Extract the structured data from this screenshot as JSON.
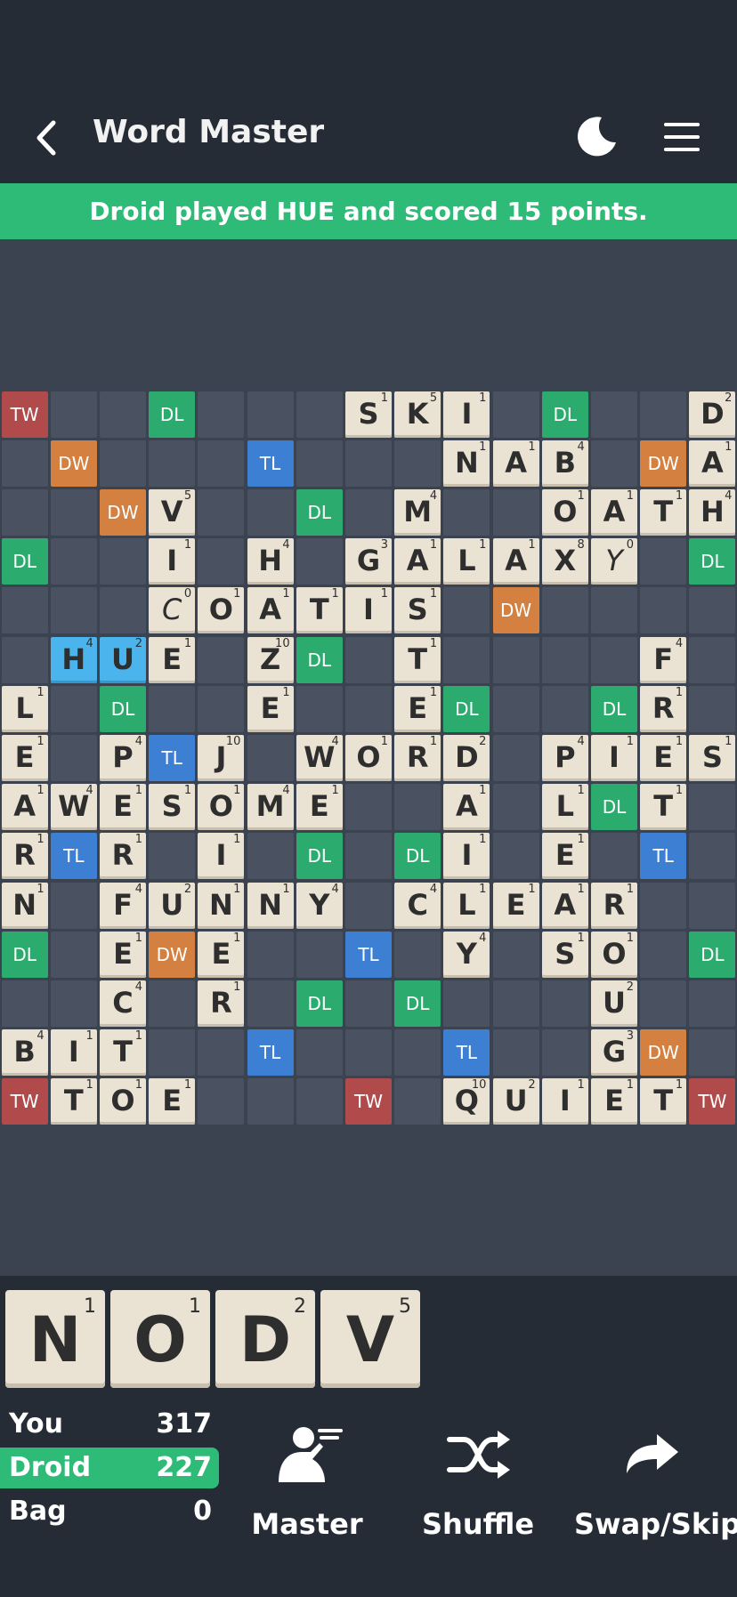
{
  "header": {
    "title": "Word Master",
    "back_icon": "chevron-left-icon",
    "theme_icon": "moon-icon",
    "menu_icon": "hamburger-menu-icon"
  },
  "banner": {
    "text": "Droid played HUE and scored 15 points."
  },
  "colors": {
    "header_bg": "#262c36",
    "board_bg": "#3b4351",
    "accent_green": "#2dbb77",
    "TW": "#b14b4b",
    "DW": "#d48040",
    "DL": "#2bab6e",
    "TL": "#3c7fd3",
    "tile": "#eae2d3",
    "last_played": "#4cb4ec"
  },
  "board": {
    "premiums": [
      [
        "TW",
        "",
        "",
        "DL",
        "",
        "",
        "",
        "",
        "",
        "",
        "",
        "DL",
        "",
        "",
        "TW"
      ],
      [
        "",
        "DW",
        "",
        "",
        "",
        "TL",
        "",
        "",
        "",
        "",
        "",
        "",
        "",
        "DW",
        ""
      ],
      [
        "",
        "",
        "DW",
        "",
        "",
        "",
        "DL",
        "",
        "",
        "",
        "",
        "",
        "",
        "",
        ""
      ],
      [
        "DL",
        "",
        "",
        "",
        "",
        "",
        "",
        "",
        "",
        "",
        "",
        "",
        "",
        "",
        "DL"
      ],
      [
        "",
        "",
        "",
        "",
        "",
        "",
        "",
        "",
        "",
        "",
        "DW",
        "",
        "",
        "",
        ""
      ],
      [
        "",
        "",
        "",
        "",
        "",
        "",
        "DL",
        "",
        "",
        "",
        "",
        "",
        "",
        "",
        ""
      ],
      [
        "",
        "",
        "DL",
        "",
        "",
        "",
        "",
        "",
        "",
        "DL",
        "",
        "",
        "DL",
        "",
        ""
      ],
      [
        "",
        "",
        "",
        "TL",
        "",
        "",
        "",
        "",
        "",
        "",
        "",
        "",
        "",
        "",
        ""
      ],
      [
        "",
        "",
        "",
        "",
        "",
        "",
        "",
        "",
        "",
        "",
        "",
        "",
        "DL",
        "",
        ""
      ],
      [
        "",
        "TL",
        "",
        "",
        "",
        "",
        "DL",
        "",
        "DL",
        "",
        "",
        "",
        "",
        "TL",
        ""
      ],
      [
        "",
        "",
        "",
        "",
        "",
        "",
        "",
        "",
        "",
        "",
        "",
        "",
        "",
        "",
        ""
      ],
      [
        "DL",
        "",
        "",
        "DW",
        "",
        "",
        "",
        "TL",
        "",
        "",
        "",
        "",
        "",
        "",
        "DL"
      ],
      [
        "",
        "",
        "",
        "",
        "",
        "",
        "DL",
        "",
        "DL",
        "",
        "",
        "",
        "",
        "",
        ""
      ],
      [
        "",
        "",
        "",
        "",
        "",
        "TL",
        "",
        "",
        "",
        "TL",
        "",
        "",
        "",
        "DW",
        ""
      ],
      [
        "TW",
        "",
        "",
        "",
        "",
        "",
        "",
        "TW",
        "",
        "",
        "",
        "",
        "",
        "",
        "TW"
      ]
    ],
    "tiles": [
      {
        "r": 0,
        "c": 7,
        "letter": "S",
        "points": 1
      },
      {
        "r": 0,
        "c": 8,
        "letter": "K",
        "points": 5
      },
      {
        "r": 0,
        "c": 9,
        "letter": "I",
        "points": 1
      },
      {
        "r": 0,
        "c": 14,
        "letter": "D",
        "points": 2
      },
      {
        "r": 1,
        "c": 9,
        "letter": "N",
        "points": 1
      },
      {
        "r": 1,
        "c": 10,
        "letter": "A",
        "points": 1
      },
      {
        "r": 1,
        "c": 11,
        "letter": "B",
        "points": 4
      },
      {
        "r": 1,
        "c": 14,
        "letter": "A",
        "points": 1
      },
      {
        "r": 2,
        "c": 3,
        "letter": "V",
        "points": 5
      },
      {
        "r": 2,
        "c": 8,
        "letter": "M",
        "points": 4
      },
      {
        "r": 2,
        "c": 11,
        "letter": "O",
        "points": 1
      },
      {
        "r": 2,
        "c": 12,
        "letter": "A",
        "points": 1
      },
      {
        "r": 2,
        "c": 13,
        "letter": "T",
        "points": 1
      },
      {
        "r": 2,
        "c": 14,
        "letter": "H",
        "points": 4
      },
      {
        "r": 3,
        "c": 3,
        "letter": "I",
        "points": 1
      },
      {
        "r": 3,
        "c": 5,
        "letter": "H",
        "points": 4
      },
      {
        "r": 3,
        "c": 7,
        "letter": "G",
        "points": 3
      },
      {
        "r": 3,
        "c": 8,
        "letter": "A",
        "points": 1
      },
      {
        "r": 3,
        "c": 9,
        "letter": "L",
        "points": 1
      },
      {
        "r": 3,
        "c": 10,
        "letter": "A",
        "points": 1
      },
      {
        "r": 3,
        "c": 11,
        "letter": "X",
        "points": 8
      },
      {
        "r": 3,
        "c": 12,
        "letter": "Y",
        "points": 0,
        "blank": true
      },
      {
        "r": 4,
        "c": 3,
        "letter": "C",
        "points": 0,
        "blank": true
      },
      {
        "r": 4,
        "c": 4,
        "letter": "O",
        "points": 1
      },
      {
        "r": 4,
        "c": 5,
        "letter": "A",
        "points": 1
      },
      {
        "r": 4,
        "c": 6,
        "letter": "T",
        "points": 1
      },
      {
        "r": 4,
        "c": 7,
        "letter": "I",
        "points": 1
      },
      {
        "r": 4,
        "c": 8,
        "letter": "S",
        "points": 1
      },
      {
        "r": 5,
        "c": 1,
        "letter": "H",
        "points": 4,
        "last": true
      },
      {
        "r": 5,
        "c": 2,
        "letter": "U",
        "points": 2,
        "last": true
      },
      {
        "r": 5,
        "c": 3,
        "letter": "E",
        "points": 1
      },
      {
        "r": 5,
        "c": 5,
        "letter": "Z",
        "points": 10
      },
      {
        "r": 5,
        "c": 8,
        "letter": "T",
        "points": 1
      },
      {
        "r": 5,
        "c": 13,
        "letter": "F",
        "points": 4
      },
      {
        "r": 6,
        "c": 0,
        "letter": "L",
        "points": 1
      },
      {
        "r": 6,
        "c": 5,
        "letter": "E",
        "points": 1
      },
      {
        "r": 6,
        "c": 8,
        "letter": "E",
        "points": 1
      },
      {
        "r": 6,
        "c": 13,
        "letter": "R",
        "points": 1
      },
      {
        "r": 7,
        "c": 0,
        "letter": "E",
        "points": 1
      },
      {
        "r": 7,
        "c": 2,
        "letter": "P",
        "points": 4
      },
      {
        "r": 7,
        "c": 4,
        "letter": "J",
        "points": 10
      },
      {
        "r": 7,
        "c": 6,
        "letter": "W",
        "points": 4
      },
      {
        "r": 7,
        "c": 7,
        "letter": "O",
        "points": 1
      },
      {
        "r": 7,
        "c": 8,
        "letter": "R",
        "points": 1
      },
      {
        "r": 7,
        "c": 9,
        "letter": "D",
        "points": 2
      },
      {
        "r": 7,
        "c": 11,
        "letter": "P",
        "points": 4
      },
      {
        "r": 7,
        "c": 12,
        "letter": "I",
        "points": 1
      },
      {
        "r": 7,
        "c": 13,
        "letter": "E",
        "points": 1
      },
      {
        "r": 7,
        "c": 14,
        "letter": "S",
        "points": 1
      },
      {
        "r": 8,
        "c": 0,
        "letter": "A",
        "points": 1
      },
      {
        "r": 8,
        "c": 1,
        "letter": "W",
        "points": 4
      },
      {
        "r": 8,
        "c": 2,
        "letter": "E",
        "points": 1
      },
      {
        "r": 8,
        "c": 3,
        "letter": "S",
        "points": 1
      },
      {
        "r": 8,
        "c": 4,
        "letter": "O",
        "points": 1
      },
      {
        "r": 8,
        "c": 5,
        "letter": "M",
        "points": 4
      },
      {
        "r": 8,
        "c": 6,
        "letter": "E",
        "points": 1
      },
      {
        "r": 8,
        "c": 9,
        "letter": "A",
        "points": 1
      },
      {
        "r": 8,
        "c": 11,
        "letter": "L",
        "points": 1
      },
      {
        "r": 8,
        "c": 13,
        "letter": "T",
        "points": 1
      },
      {
        "r": 9,
        "c": 0,
        "letter": "R",
        "points": 1
      },
      {
        "r": 9,
        "c": 2,
        "letter": "R",
        "points": 1
      },
      {
        "r": 9,
        "c": 4,
        "letter": "I",
        "points": 1
      },
      {
        "r": 9,
        "c": 9,
        "letter": "I",
        "points": 1
      },
      {
        "r": 9,
        "c": 11,
        "letter": "E",
        "points": 1
      },
      {
        "r": 10,
        "c": 0,
        "letter": "N",
        "points": 1
      },
      {
        "r": 10,
        "c": 2,
        "letter": "F",
        "points": 4
      },
      {
        "r": 10,
        "c": 3,
        "letter": "U",
        "points": 2
      },
      {
        "r": 10,
        "c": 4,
        "letter": "N",
        "points": 1
      },
      {
        "r": 10,
        "c": 5,
        "letter": "N",
        "points": 1
      },
      {
        "r": 10,
        "c": 6,
        "letter": "Y",
        "points": 4
      },
      {
        "r": 10,
        "c": 8,
        "letter": "C",
        "points": 4
      },
      {
        "r": 10,
        "c": 9,
        "letter": "L",
        "points": 1
      },
      {
        "r": 10,
        "c": 10,
        "letter": "E",
        "points": 1
      },
      {
        "r": 10,
        "c": 11,
        "letter": "A",
        "points": 1
      },
      {
        "r": 10,
        "c": 12,
        "letter": "R",
        "points": 1
      },
      {
        "r": 11,
        "c": 2,
        "letter": "E",
        "points": 1
      },
      {
        "r": 11,
        "c": 4,
        "letter": "E",
        "points": 1
      },
      {
        "r": 11,
        "c": 9,
        "letter": "Y",
        "points": 4
      },
      {
        "r": 11,
        "c": 11,
        "letter": "S",
        "points": 1
      },
      {
        "r": 11,
        "c": 12,
        "letter": "O",
        "points": 1
      },
      {
        "r": 12,
        "c": 2,
        "letter": "C",
        "points": 4
      },
      {
        "r": 12,
        "c": 4,
        "letter": "R",
        "points": 1
      },
      {
        "r": 12,
        "c": 12,
        "letter": "U",
        "points": 2
      },
      {
        "r": 13,
        "c": 0,
        "letter": "B",
        "points": 4
      },
      {
        "r": 13,
        "c": 1,
        "letter": "I",
        "points": 1
      },
      {
        "r": 13,
        "c": 2,
        "letter": "T",
        "points": 1
      },
      {
        "r": 13,
        "c": 12,
        "letter": "G",
        "points": 3
      },
      {
        "r": 14,
        "c": 1,
        "letter": "T",
        "points": 1
      },
      {
        "r": 14,
        "c": 2,
        "letter": "O",
        "points": 1
      },
      {
        "r": 14,
        "c": 3,
        "letter": "E",
        "points": 1
      },
      {
        "r": 14,
        "c": 9,
        "letter": "Q",
        "points": 10
      },
      {
        "r": 14,
        "c": 10,
        "letter": "U",
        "points": 2
      },
      {
        "r": 14,
        "c": 11,
        "letter": "I",
        "points": 1
      },
      {
        "r": 14,
        "c": 12,
        "letter": "E",
        "points": 1
      },
      {
        "r": 14,
        "c": 13,
        "letter": "T",
        "points": 1
      }
    ]
  },
  "rack": [
    {
      "letter": "N",
      "points": "1"
    },
    {
      "letter": "O",
      "points": "1"
    },
    {
      "letter": "D",
      "points": "2"
    },
    {
      "letter": "V",
      "points": "5"
    }
  ],
  "scores": [
    {
      "name": "You",
      "value": "317",
      "active": false
    },
    {
      "name": "Droid",
      "value": "227",
      "active": true
    },
    {
      "name": "Bag",
      "value": "0",
      "active": false
    }
  ],
  "actions": [
    {
      "label": "Master",
      "icon": "master-hint-icon"
    },
    {
      "label": "Shuffle",
      "icon": "shuffle-icon"
    },
    {
      "label": "Swap/Skip",
      "icon": "swap-skip-arrow-icon"
    }
  ]
}
